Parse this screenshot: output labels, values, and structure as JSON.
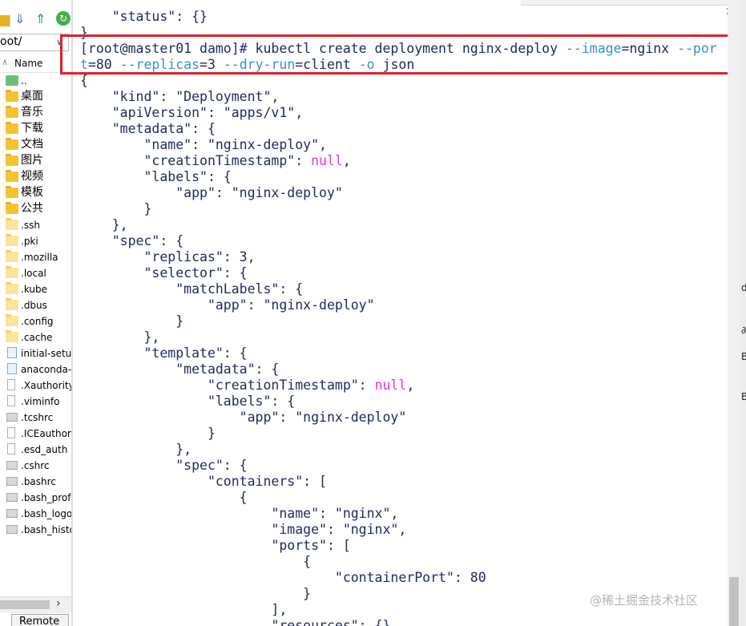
{
  "toolbar": {
    "icons": [
      "folder-icon",
      "download-icon",
      "upload-icon",
      "refresh-icon"
    ]
  },
  "file_panel": {
    "path": "oot/",
    "column_name": "Name",
    "items": [
      {
        "name": "..",
        "icon": "up"
      },
      {
        "name": "桌面",
        "icon": "folder"
      },
      {
        "name": "音乐",
        "icon": "folder"
      },
      {
        "name": "下载",
        "icon": "folder"
      },
      {
        "name": "文档",
        "icon": "folder"
      },
      {
        "name": "图片",
        "icon": "folder"
      },
      {
        "name": "视频",
        "icon": "folder"
      },
      {
        "name": "模板",
        "icon": "folder"
      },
      {
        "name": "公共",
        "icon": "folder"
      },
      {
        "name": ".ssh",
        "icon": "dot"
      },
      {
        "name": ".pki",
        "icon": "dot"
      },
      {
        "name": ".mozilla",
        "icon": "dot"
      },
      {
        "name": ".local",
        "icon": "dot"
      },
      {
        "name": ".kube",
        "icon": "dot"
      },
      {
        "name": ".dbus",
        "icon": "dot"
      },
      {
        "name": ".config",
        "icon": "dot"
      },
      {
        "name": ".cache",
        "icon": "dot"
      },
      {
        "name": "initial-setu",
        "icon": "img"
      },
      {
        "name": "anaconda-",
        "icon": "img"
      },
      {
        "name": ".Xauthority",
        "icon": "doc"
      },
      {
        "name": ".viminfo",
        "icon": "doc"
      },
      {
        "name": ".tcshrc",
        "icon": "gray"
      },
      {
        "name": ".ICEauthor",
        "icon": "doc"
      },
      {
        "name": ".esd_auth",
        "icon": "doc"
      },
      {
        "name": ".cshrc",
        "icon": "gray"
      },
      {
        "name": ".bashrc",
        "icon": "gray"
      },
      {
        "name": ".bash_prof",
        "icon": "gray"
      },
      {
        "name": ".bash_logo",
        "icon": "gray"
      },
      {
        "name": ".bash_histo",
        "icon": "gray"
      }
    ],
    "remote_tab": "Remote"
  },
  "terminal": {
    "prompt": "[root@master01 damo]# ",
    "command": "kubectl create deployment nginx-deploy --image=nginx --port=80 --replicas=3 --dry-run=client -o json",
    "lines": [
      "    \"status\": {}",
      "}",
      "@@CMD1@@",
      "@@CMD2@@",
      "{",
      "    \"kind\": \"Deployment\",",
      "    \"apiVersion\": \"apps/v1\",",
      "    \"metadata\": {",
      "        \"name\": \"nginx-deploy\",",
      "        \"creationTimestamp\": null,",
      "        \"labels\": {",
      "            \"app\": \"nginx-deploy\"",
      "        }",
      "    },",
      "    \"spec\": {",
      "        \"replicas\": 3,",
      "        \"selector\": {",
      "            \"matchLabels\": {",
      "                \"app\": \"nginx-deploy\"",
      "            }",
      "        },",
      "        \"template\": {",
      "            \"metadata\": {",
      "                \"creationTimestamp\": null,",
      "                \"labels\": {",
      "                    \"app\": \"nginx-deploy\"",
      "                }",
      "            },",
      "            \"spec\": {",
      "                \"containers\": [",
      "                    {",
      "                        \"name\": \"nginx\",",
      "                        \"image\": \"nginx\",",
      "                        \"ports\": [",
      "                            {",
      "                                \"containerPort\": 80",
      "                            }",
      "                        ],",
      "                        \"resources\": {}"
    ]
  },
  "watermark": "@稀土掘金技术社区",
  "colors": {
    "terminal_text": "#1d2a5c",
    "null_keyword": "#e23bd0",
    "flag": "#3e8fc9",
    "highlight_box": "#e0202a"
  }
}
